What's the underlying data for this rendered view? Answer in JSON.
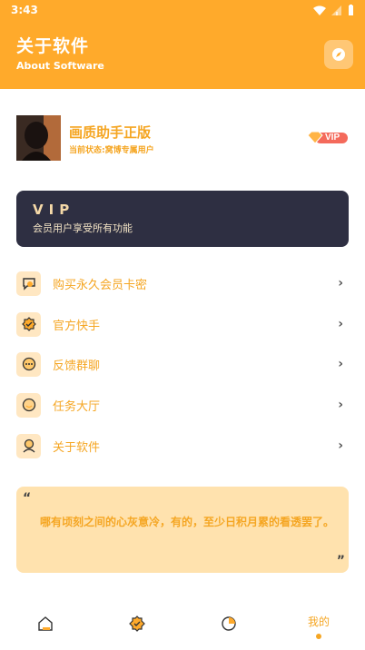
{
  "status_bar": {
    "time": "3:43"
  },
  "header": {
    "title": "关于软件",
    "subtitle": "About Software"
  },
  "profile": {
    "name": "画质助手正版",
    "status": "当前状态:窝博专属用户",
    "badge": "VIP"
  },
  "vip_card": {
    "title": "VIP",
    "description": "会员用户享受所有功能"
  },
  "menu": [
    {
      "label": "购买永久会员卡密",
      "icon": "chat-icon"
    },
    {
      "label": "官方快手",
      "icon": "badge-check-icon"
    },
    {
      "label": "反馈群聊",
      "icon": "dots-chat-icon"
    },
    {
      "label": "任务大厅",
      "icon": "circle-icon"
    },
    {
      "label": "关于软件",
      "icon": "user-icon"
    }
  ],
  "quote": {
    "open": "“",
    "close": "”",
    "text": "哪有顷刻之间的心灰意冷，有的，至少日积月累的看透罢了。"
  },
  "tabbar": {
    "active_label": "我的"
  },
  "colors": {
    "accent": "#FFAA2B",
    "text_accent": "#F5A623",
    "dark_card": "#2E2F42"
  }
}
